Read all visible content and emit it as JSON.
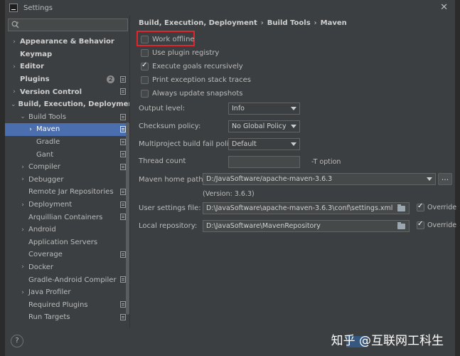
{
  "window": {
    "title": "Settings",
    "close_symbol": "✕"
  },
  "search": {
    "placeholder": "",
    "icon": "search-icon"
  },
  "sidebar": {
    "items": [
      {
        "label": "Appearance & Behavior",
        "arrow": "›",
        "bold": true
      },
      {
        "label": "Keymap",
        "arrow": "",
        "bold": true
      },
      {
        "label": "Editor",
        "arrow": "›",
        "bold": true
      },
      {
        "label": "Plugins",
        "arrow": "",
        "bold": true,
        "badge": "2"
      },
      {
        "label": "Version Control",
        "arrow": "›",
        "bold": true
      },
      {
        "label": "Build, Execution, Deployment",
        "arrow": "⌄",
        "bold": true
      },
      {
        "label": "Build Tools",
        "arrow": "⌄"
      },
      {
        "label": "Maven",
        "arrow": "›",
        "selected": true
      },
      {
        "label": "Gradle",
        "arrow": ""
      },
      {
        "label": "Gant",
        "arrow": ""
      },
      {
        "label": "Compiler",
        "arrow": "›"
      },
      {
        "label": "Debugger",
        "arrow": "›"
      },
      {
        "label": "Remote Jar Repositories",
        "arrow": ""
      },
      {
        "label": "Deployment",
        "arrow": "›"
      },
      {
        "label": "Arquillian Containers",
        "arrow": ""
      },
      {
        "label": "Android",
        "arrow": "›"
      },
      {
        "label": "Application Servers",
        "arrow": ""
      },
      {
        "label": "Coverage",
        "arrow": ""
      },
      {
        "label": "Docker",
        "arrow": "›"
      },
      {
        "label": "Gradle-Android Compiler",
        "arrow": ""
      },
      {
        "label": "Java Profiler",
        "arrow": "›"
      },
      {
        "label": "Required Plugins",
        "arrow": ""
      },
      {
        "label": "Run Targets",
        "arrow": ""
      }
    ]
  },
  "breadcrumb": {
    "part1": "Build, Execution, Deployment",
    "sep1": "›",
    "part2": "Build Tools",
    "sep2": "›",
    "part3": "Maven"
  },
  "options": {
    "work_offline": {
      "label": "Work offline",
      "checked": false
    },
    "use_plugin_registry": {
      "label": "Use plugin registry",
      "checked": false
    },
    "execute_goals_recursively": {
      "label": "Execute goals recursively",
      "checked": true
    },
    "print_exception_stack_traces": {
      "label": "Print exception stack traces",
      "checked": false
    },
    "always_update_snapshots": {
      "label": "Always update snapshots",
      "checked": false
    }
  },
  "form": {
    "output_level": {
      "label": "Output level:",
      "value": "Info"
    },
    "checksum_policy": {
      "label": "Checksum policy:",
      "value": "No Global Policy"
    },
    "multiproject_policy": {
      "label": "Multiproject build fail policy:",
      "value": "Default"
    },
    "thread_count": {
      "label": "Thread count",
      "value": "",
      "hint": "-T option"
    },
    "maven_home": {
      "label": "Maven home path:",
      "value": "D:/JavaSoftware/apache-maven-3.6.3",
      "version": "(Version: 3.6.3)",
      "browse": "..."
    },
    "user_settings": {
      "label": "User settings file:",
      "value": "D:\\JavaSoftware\\apache-maven-3.6.3\\conf\\settings.xml",
      "override_label": "Override",
      "override_checked": true
    },
    "local_repo": {
      "label": "Local repository:",
      "value": "D:\\JavaSoftware\\MavenRepository",
      "override_label": "Override",
      "override_checked": true
    }
  },
  "footer": {
    "help": "?",
    "watermark": "知乎 @互联网工科生"
  },
  "colors": {
    "selection": "#4b6eaf",
    "highlight_border": "#e0262b",
    "background": "#3c3f41"
  }
}
